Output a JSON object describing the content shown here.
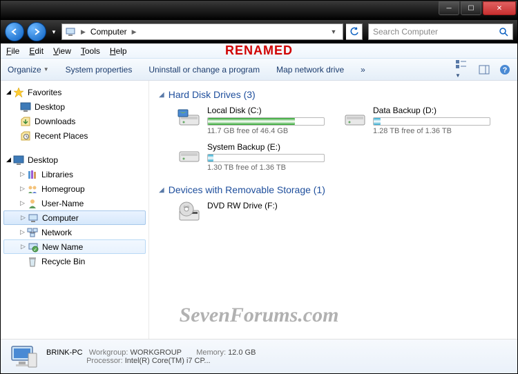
{
  "title_annotation": "RENAMED",
  "watermark": "SevenForums.com",
  "nav": {
    "location": "Computer"
  },
  "search": {
    "placeholder": "Search Computer"
  },
  "menu": {
    "file": "File",
    "edit": "Edit",
    "view": "View",
    "tools": "Tools",
    "help": "Help"
  },
  "toolbar": {
    "organize": "Organize",
    "sysprops": "System properties",
    "uninstall": "Uninstall or change a program",
    "mapdrive": "Map network drive",
    "more": "»"
  },
  "sidebar": {
    "favorites": {
      "label": "Favorites",
      "items": [
        {
          "label": "Desktop"
        },
        {
          "label": "Downloads"
        },
        {
          "label": "Recent Places"
        }
      ]
    },
    "desktop": {
      "label": "Desktop",
      "items": [
        {
          "label": "Libraries"
        },
        {
          "label": "Homegroup"
        },
        {
          "label": "User-Name"
        },
        {
          "label": "Computer"
        },
        {
          "label": "Network"
        },
        {
          "label": "New Name"
        },
        {
          "label": "Recycle Bin"
        }
      ]
    }
  },
  "sections": {
    "hdd": {
      "title": "Hard Disk Drives (3)",
      "drives": [
        {
          "name": "Local Disk (C:)",
          "free": "11.7 GB free of 46.4 GB",
          "used_pct": 75,
          "color": "#29a329"
        },
        {
          "name": "Data Backup (D:)",
          "free": "1.28 TB free of 1.36 TB",
          "used_pct": 6,
          "color": "#2aa8cf"
        },
        {
          "name": "System Backup (E:)",
          "free": "1.30 TB free of 1.36 TB",
          "used_pct": 5,
          "color": "#2aa8cf"
        }
      ]
    },
    "removable": {
      "title": "Devices with Removable Storage (1)",
      "drives": [
        {
          "name": "DVD RW Drive (F:)"
        }
      ]
    }
  },
  "status": {
    "name": "BRINK-PC",
    "workgroup_label": "Workgroup:",
    "workgroup": "WORKGROUP",
    "memory_label": "Memory:",
    "memory": "12.0 GB",
    "processor_label": "Processor:",
    "processor": "Intel(R) Core(TM) i7 CP..."
  }
}
